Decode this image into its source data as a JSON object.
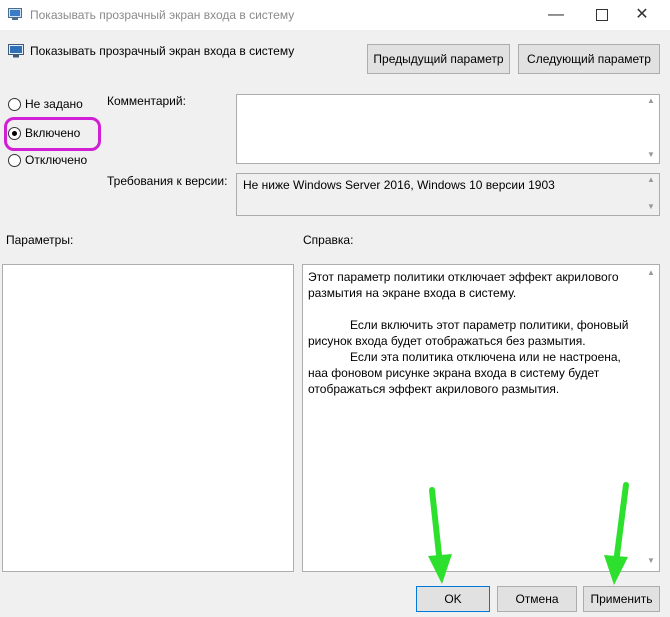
{
  "window": {
    "title": "Показывать прозрачный экран входа в систему",
    "minimize_glyph": "—",
    "close_glyph": "✕"
  },
  "header": {
    "title": "Показывать прозрачный экран входа в систему",
    "prev_button": "Предыдущий параметр",
    "next_button": "Следующий параметр"
  },
  "state": {
    "not_configured": "Не задано",
    "enabled": "Включено",
    "disabled": "Отключено",
    "selected": "enabled"
  },
  "comment": {
    "label": "Комментарий:",
    "value": ""
  },
  "requirements": {
    "label": "Требования к версии:",
    "value": "Не ниже Windows Server 2016, Windows 10 версии 1903"
  },
  "options": {
    "label": "Параметры:"
  },
  "help": {
    "label": "Справка:",
    "paragraph1": "Этот параметр политики отключает эффект акрилового размытия на экране входа в систему.",
    "paragraph2": "Если включить этот параметр политики, фоновый рисунок входа будет отображаться без размытия.",
    "paragraph3": "Если эта политика отключена или не настроена, наа фоновом рисунке экрана входа в систему будет отображаться эффект акрилового размытия."
  },
  "footer": {
    "ok": "OK",
    "cancel": "Отмена",
    "apply": "Применить"
  },
  "colors": {
    "highlight": "#d01fd4",
    "arrow": "#2ee02e"
  }
}
